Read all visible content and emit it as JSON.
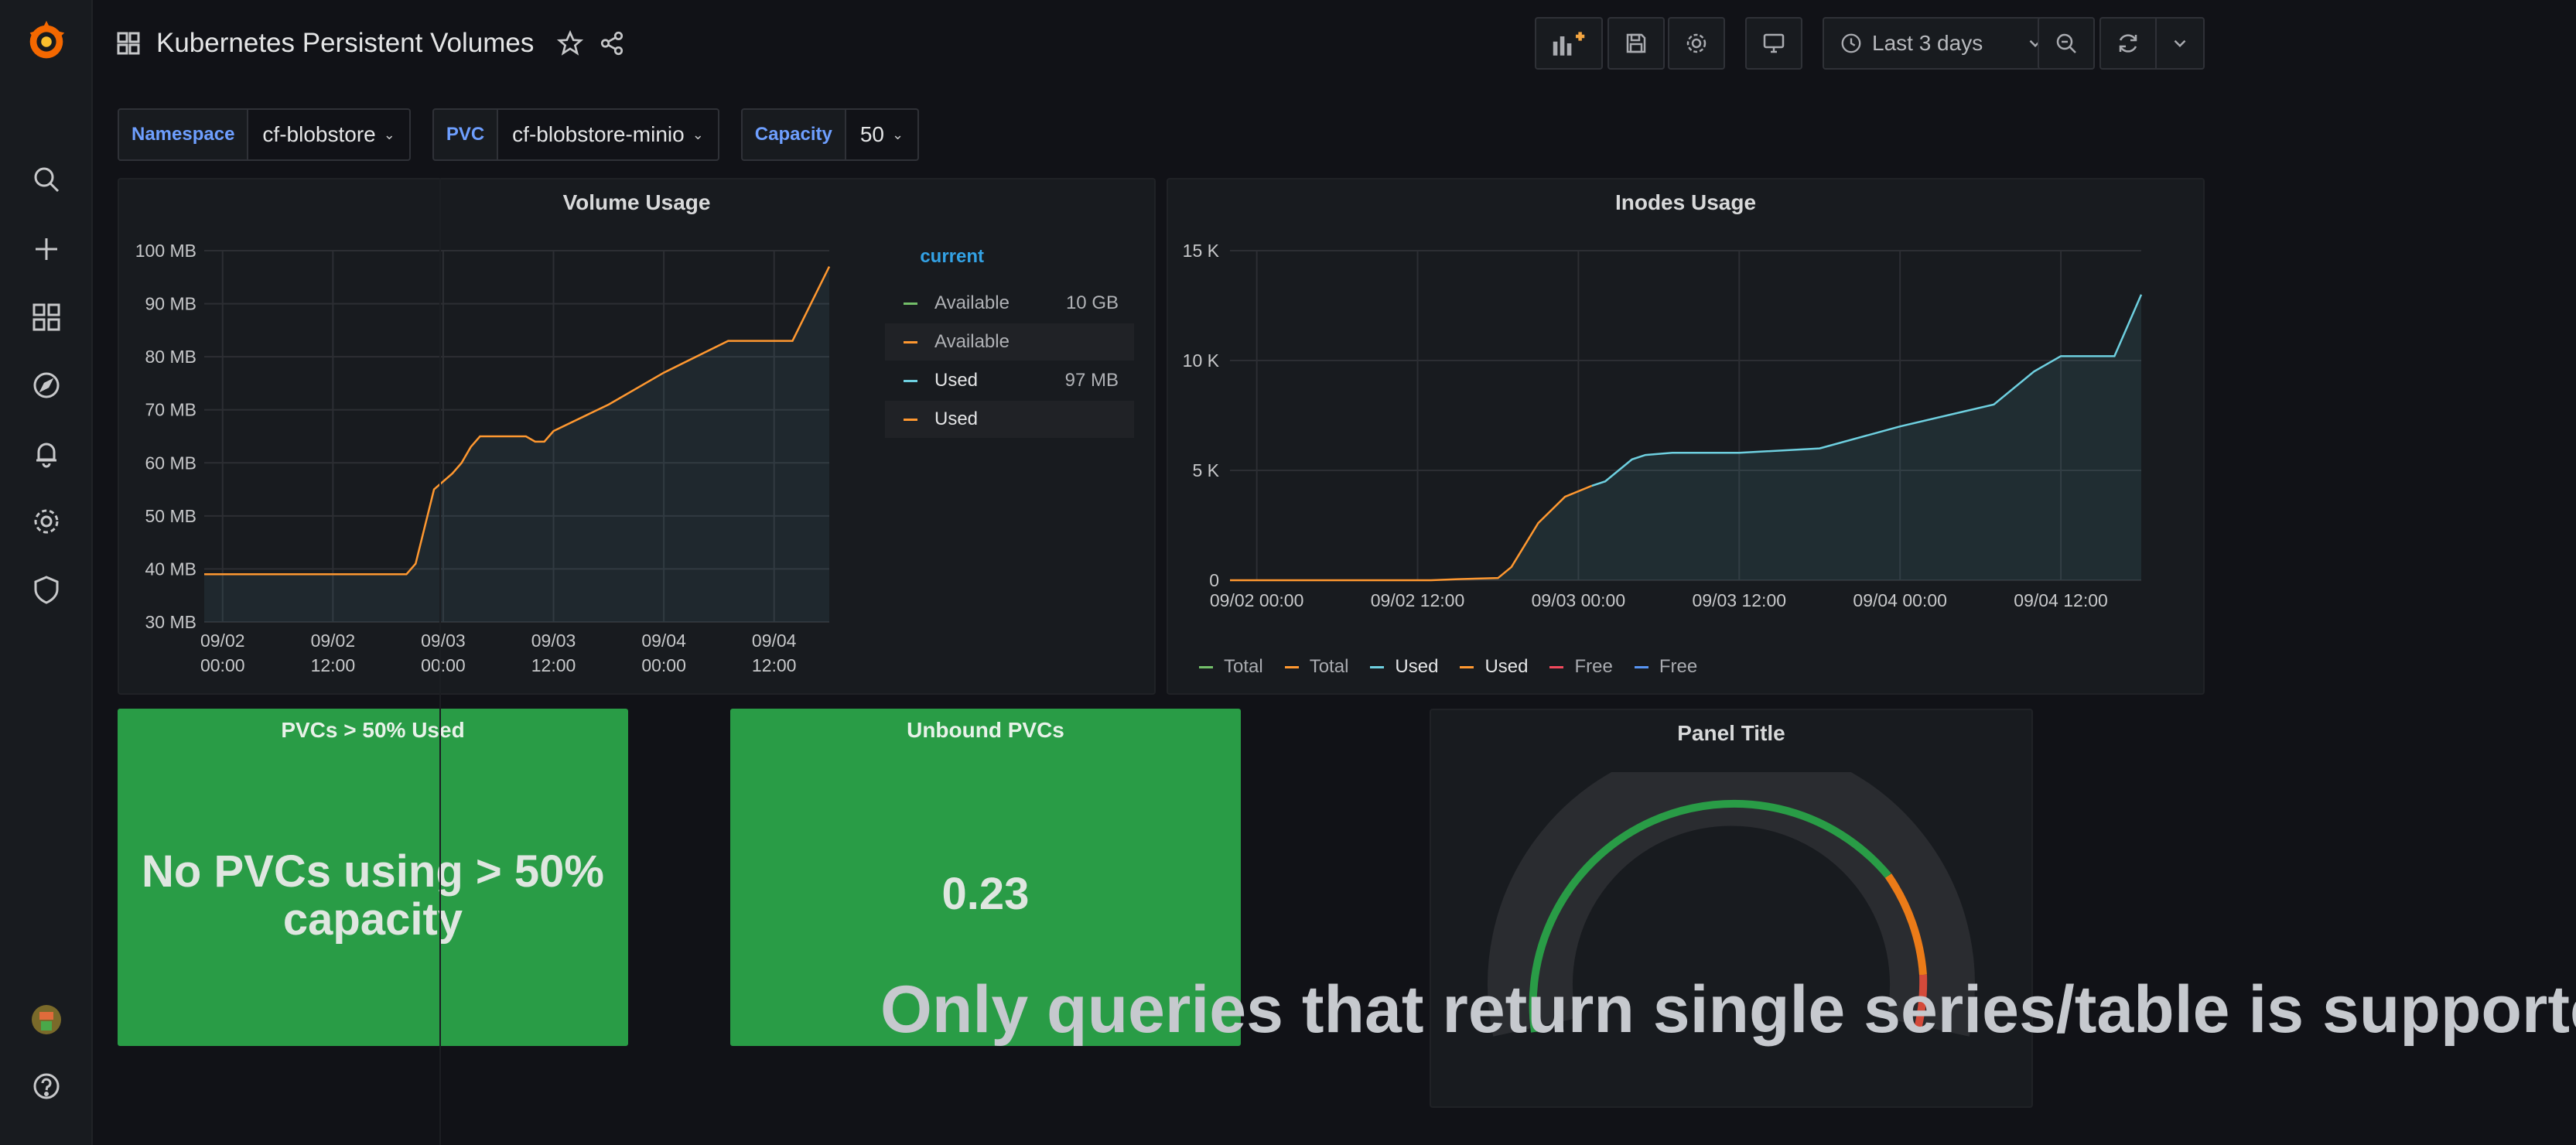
{
  "dashboard": {
    "title": "Kubernetes Persistent Volumes"
  },
  "toolbar": {
    "time_range": "Last 3 days"
  },
  "variables": [
    {
      "label": "Namespace",
      "value": "cf-blobstore"
    },
    {
      "label": "PVC",
      "value": "cf-blobstore-minio"
    },
    {
      "label": "Capacity",
      "value": "50"
    }
  ],
  "volume_panel": {
    "title": "Volume Usage",
    "legend_header": "current",
    "legend": [
      {
        "name": "Available",
        "value": "10 GB",
        "color": "#73bf69"
      },
      {
        "name": "Available",
        "value": "",
        "color": "#ff9830"
      },
      {
        "name": "Used",
        "value": "97 MB",
        "color": "#6ed0e0"
      },
      {
        "name": "Used",
        "value": "",
        "color": "#ff9830"
      }
    ]
  },
  "inodes_panel": {
    "title": "Inodes Usage",
    "legend": [
      {
        "name": "Total",
        "color": "#73bf69"
      },
      {
        "name": "Total",
        "color": "#ff9830"
      },
      {
        "name": "Used",
        "color": "#6ed0e0"
      },
      {
        "name": "Used",
        "color": "#ff9830"
      },
      {
        "name": "Free",
        "color": "#f2495c"
      },
      {
        "name": "Free",
        "color": "#5794f2"
      }
    ]
  },
  "stat_pvc_used": {
    "title": "PVCs > 50% Used",
    "line1": "No PVCs using > 50%",
    "line2": "capacity"
  },
  "stat_unbound": {
    "title": "Unbound PVCs",
    "value": "0.23"
  },
  "gauge_panel": {
    "title": "Panel Title",
    "error": "Only queries that return single series/table is supported"
  },
  "chart_data": [
    {
      "type": "line",
      "title": "Volume Usage",
      "ylim": [
        30,
        100
      ],
      "yticks": [
        "100 MB",
        "90 MB",
        "80 MB",
        "70 MB",
        "60 MB",
        "50 MB",
        "40 MB",
        "30 MB"
      ],
      "xticks": [
        [
          "09/02",
          "00:00"
        ],
        [
          "09/02",
          "12:00"
        ],
        [
          "09/03",
          "00:00"
        ],
        [
          "09/03",
          "12:00"
        ],
        [
          "09/04",
          "00:00"
        ],
        [
          "09/04",
          "12:00"
        ]
      ],
      "series": [
        {
          "name": "Used",
          "unit": "MB",
          "hours": [
            -4,
            0,
            12,
            16,
            20,
            22,
            24,
            26,
            30,
            34,
            36,
            40,
            42,
            44,
            46,
            50,
            52,
            54,
            56,
            58,
            62,
            64,
            66,
            68,
            70,
            72,
            84,
            96,
            110,
            112,
            118,
            124,
            128,
            132
          ],
          "values": [
            39,
            39,
            39,
            39,
            39,
            39,
            39,
            39,
            39,
            39,
            39,
            39,
            41,
            48,
            55,
            58,
            60,
            63,
            65,
            65,
            65,
            65,
            65,
            64,
            64,
            66,
            71,
            77,
            83,
            83,
            83,
            83,
            90,
            97
          ]
        }
      ]
    },
    {
      "type": "line",
      "title": "Inodes Usage",
      "ylim": [
        0,
        15000
      ],
      "yticks": [
        "15 K",
        "10 K",
        "5 K",
        "0"
      ],
      "xticks": [
        "09/02 00:00",
        "09/02 12:00",
        "09/03 00:00",
        "09/03 12:00",
        "09/04 00:00",
        "09/04 12:00"
      ],
      "series": [
        {
          "name": "Used",
          "hours": [
            -4,
            0,
            12,
            16,
            18,
            20,
            22,
            24,
            26,
            30,
            36,
            38,
            40,
            42,
            46,
            50,
            52,
            54,
            56,
            58,
            62,
            64,
            66,
            68,
            70,
            72,
            84,
            96,
            110,
            116,
            120,
            124,
            128,
            132
          ],
          "values": [
            0,
            0,
            0,
            0,
            0,
            0,
            0,
            0,
            0,
            50,
            100,
            600,
            1600,
            2600,
            3800,
            4300,
            4500,
            5000,
            5500,
            5700,
            5800,
            5800,
            5800,
            5800,
            5800,
            5800,
            6000,
            7000,
            8000,
            9500,
            10200,
            10200,
            10200,
            13000
          ]
        }
      ]
    }
  ]
}
